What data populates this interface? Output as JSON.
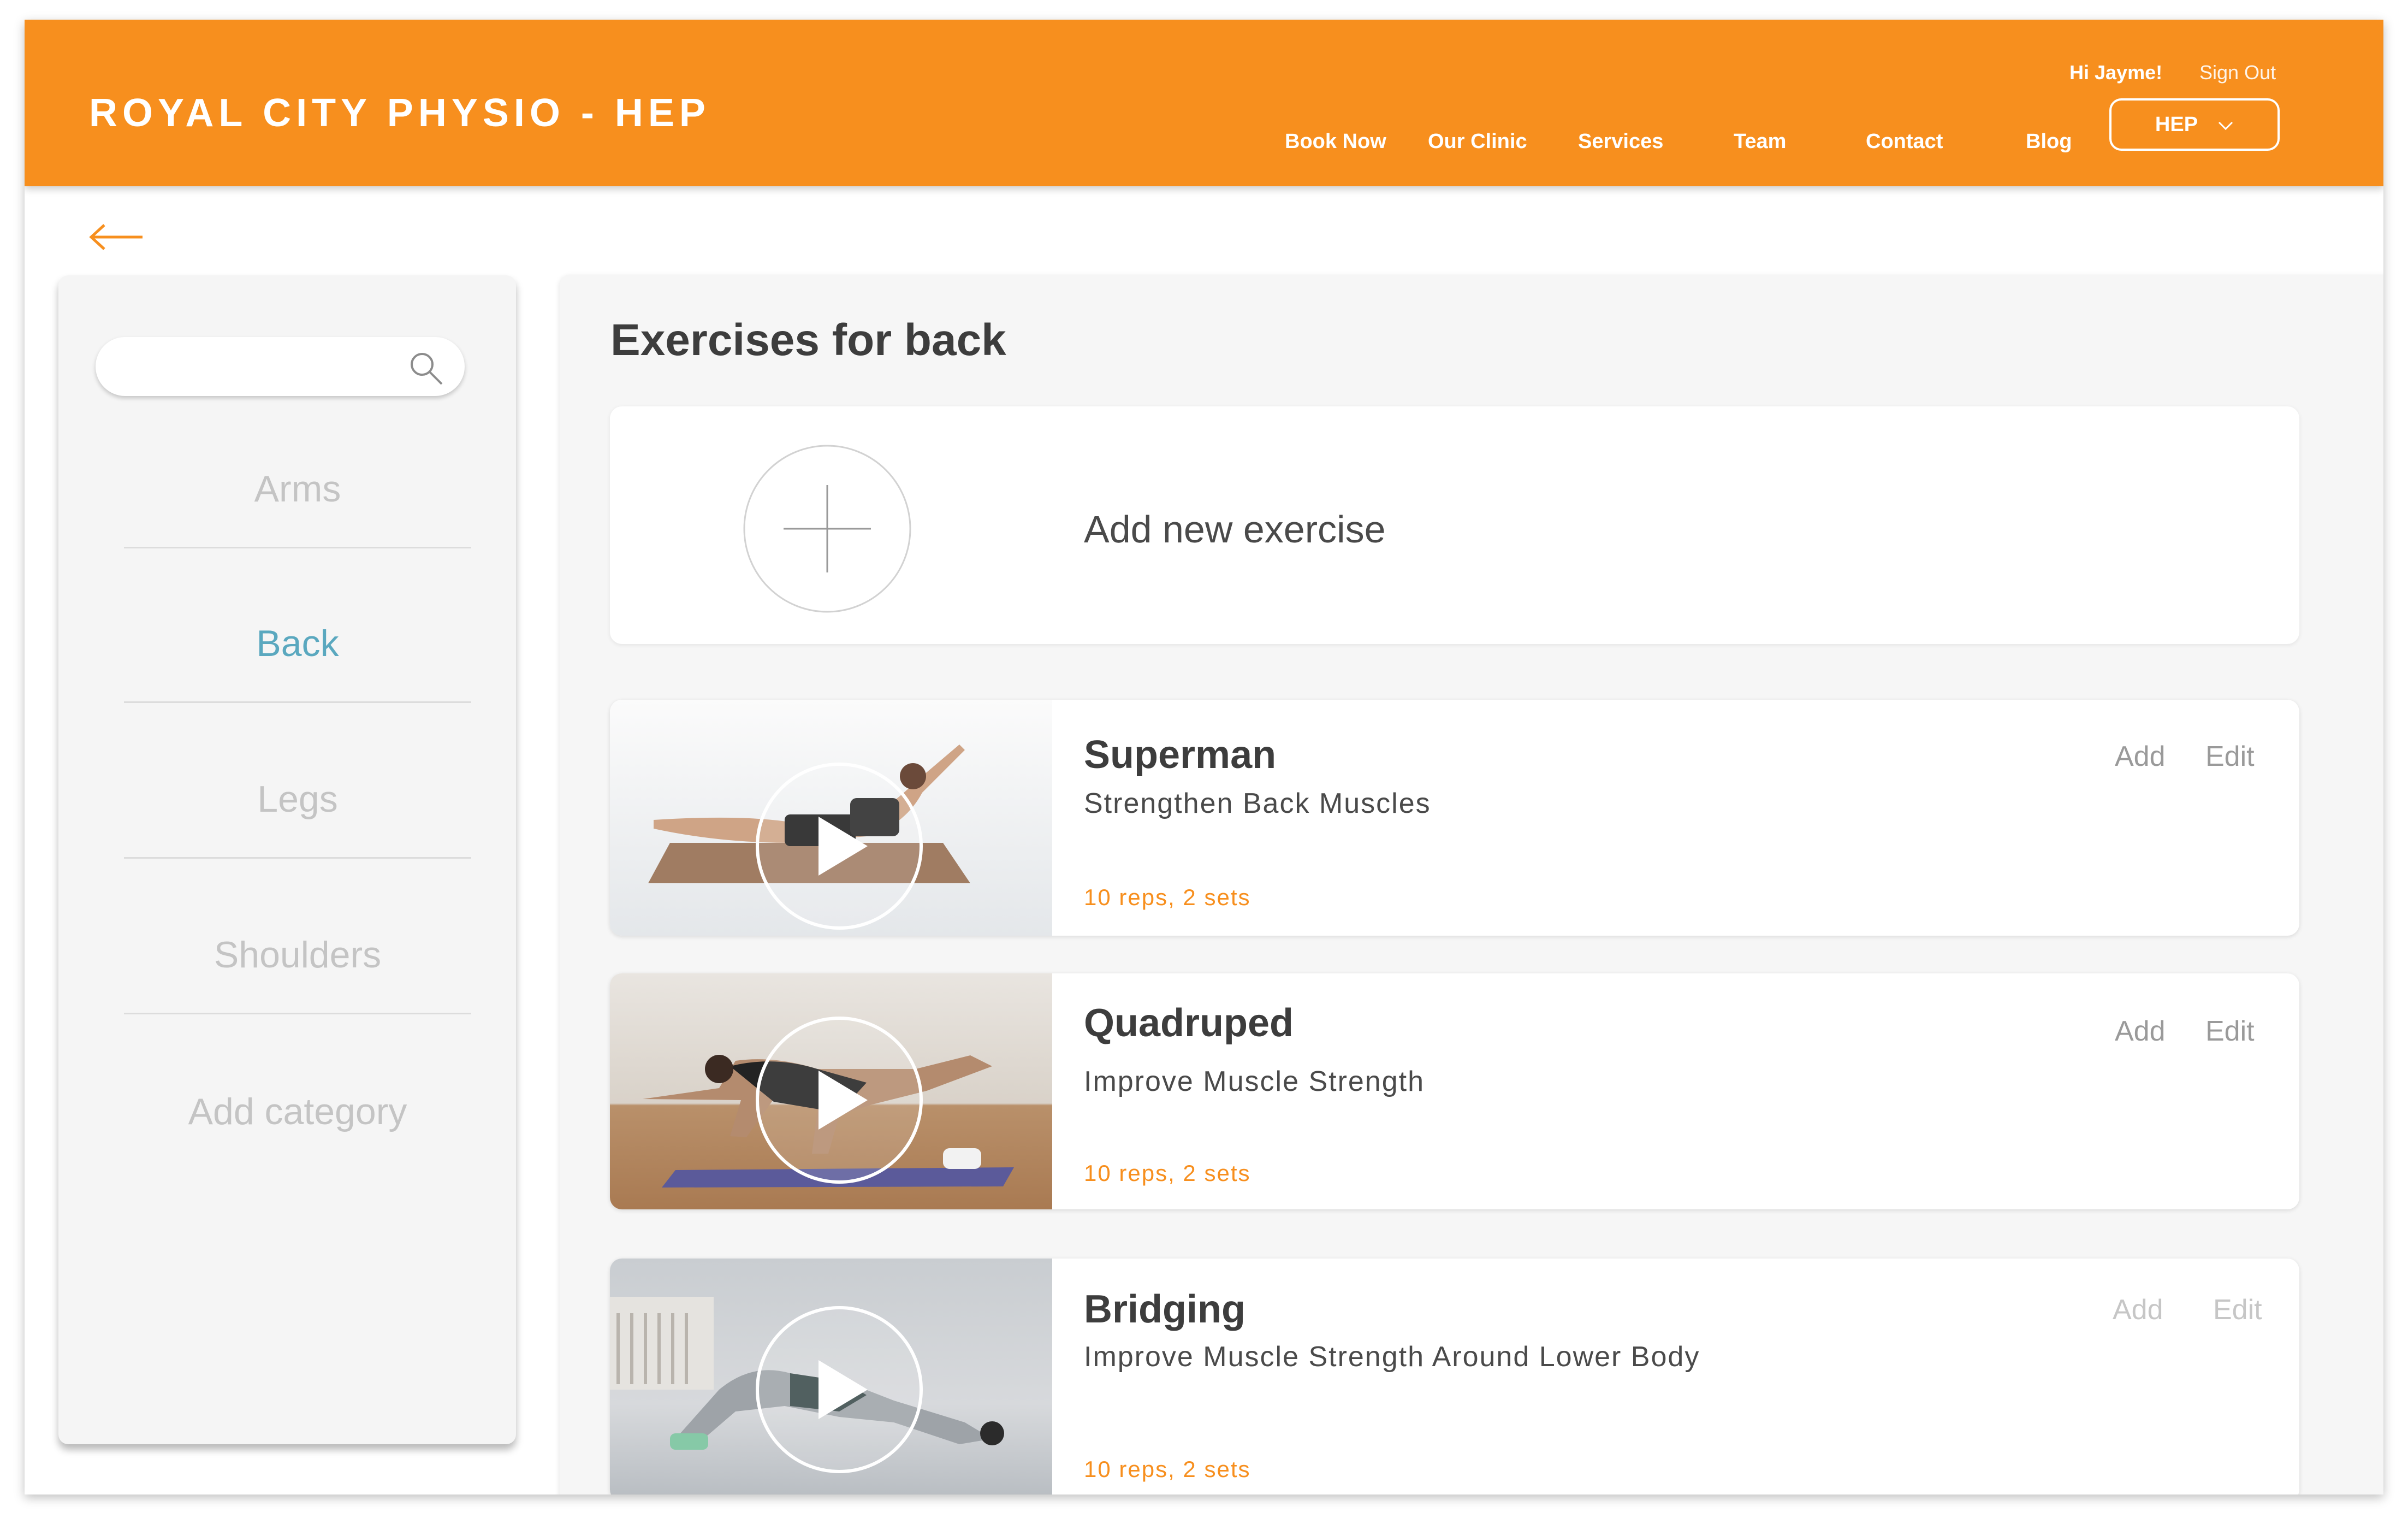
{
  "header": {
    "brand": "ROYAL CITY PHYSIO - HEP",
    "greeting": "Hi Jayme!",
    "sign_out": "Sign Out",
    "nav": [
      "Book Now",
      "Our Clinic",
      "Services",
      "Team",
      "Contact",
      "Blog"
    ],
    "hep_dropdown": "HEP"
  },
  "sidebar": {
    "search": {
      "placeholder": "",
      "value": ""
    },
    "categories": [
      "Arms",
      "Back",
      "Legs",
      "Shoulders",
      "Add category"
    ],
    "active_category": "Back"
  },
  "main": {
    "title": "Exercises for back",
    "add_new_label": "Add new exercise",
    "exercises": [
      {
        "name": "Superman",
        "description": "Strengthen Back Muscles",
        "reps": "10 reps, 2 sets",
        "add": "Add",
        "edit": "Edit"
      },
      {
        "name": "Quadruped",
        "description": "Improve Muscle Strength",
        "reps": "10 reps, 2 sets",
        "add": "Add",
        "edit": "Edit"
      },
      {
        "name": "Bridging",
        "description": "Improve Muscle Strength Around Lower Body",
        "reps": "10 reps, 2 sets",
        "add": "Add",
        "edit": "Edit"
      }
    ]
  },
  "colors": {
    "brand_orange": "#f78f1e",
    "active_category": "#5aa8bf",
    "inactive_category": "#c4c4c4",
    "title_text": "#3d3d3d"
  },
  "icons": [
    "back-arrow-icon",
    "search-icon",
    "chevron-down-icon",
    "plus-icon",
    "play-icon"
  ]
}
